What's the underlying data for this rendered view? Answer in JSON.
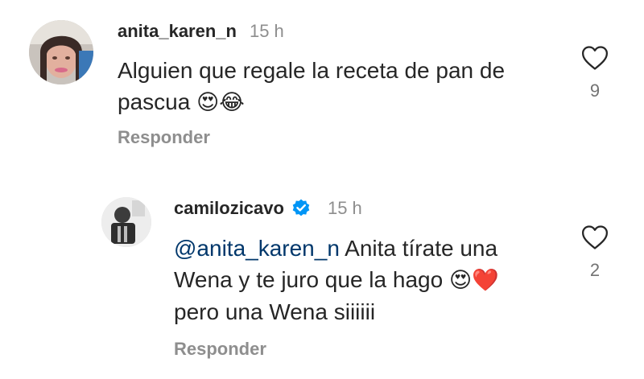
{
  "comments": [
    {
      "username": "anita_karen_n",
      "time": "15 h",
      "text_line1": "Alguien que regale la receta de pan de",
      "text_line2": "pascua",
      "emojis": "😍😂",
      "reply_label": "Responder",
      "likes": "9"
    },
    {
      "username": "camilozicavo",
      "verified": true,
      "time": "15 h",
      "mention": "@anita_karen_n",
      "text_line1": " Anita tírate una",
      "text_line2": "Wena y te juro que la hago ",
      "emojis": "😍❤️",
      "text_line3": "pero una Wena siiiiii",
      "reply_label": "Responder",
      "likes": "2"
    }
  ],
  "icons": {
    "heart": "heart-outline-icon",
    "verified": "verified-badge-icon"
  },
  "colors": {
    "verified": "#0095f6",
    "mention": "#00376b",
    "secondary": "#8e8e8e"
  }
}
